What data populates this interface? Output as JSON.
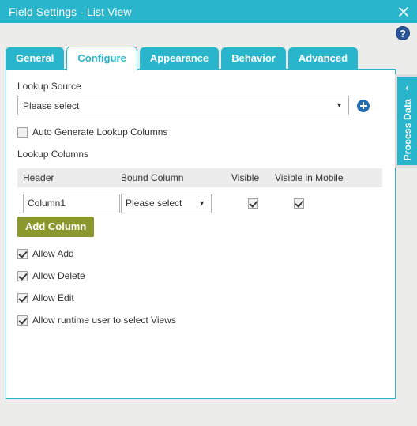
{
  "window": {
    "title": "Field Settings - List View",
    "close_icon": "close-icon",
    "help_icon": "help-icon",
    "help_glyph": "?"
  },
  "tabs": [
    {
      "label": "General",
      "active": false
    },
    {
      "label": "Configure",
      "active": true
    },
    {
      "label": "Appearance",
      "active": false
    },
    {
      "label": "Behavior",
      "active": false
    },
    {
      "label": "Advanced",
      "active": false
    }
  ],
  "configure": {
    "lookup_source_label": "Lookup Source",
    "lookup_source_value": "Please select",
    "lookup_source_caret": "▼",
    "add_lookup_source_icon": "plus-icon",
    "auto_generate_label": "Auto Generate Lookup Columns",
    "auto_generate_checked": false,
    "lookup_columns_label": "Lookup Columns",
    "grid": {
      "headers": [
        "Header",
        "Bound Column",
        "Visible",
        "Visible in Mobile"
      ],
      "rows": [
        {
          "header_value": "Column1",
          "bound_column_value": "Please select",
          "bound_column_caret": "▼",
          "visible_checked": true,
          "visible_in_mobile_checked": true
        }
      ]
    },
    "add_column_label": "Add Column",
    "permissions": [
      {
        "label": "Allow Add",
        "checked": true
      },
      {
        "label": "Allow Delete",
        "checked": true
      },
      {
        "label": "Allow Edit",
        "checked": true
      },
      {
        "label": "Allow runtime user to select Views",
        "checked": true
      }
    ]
  },
  "side_panel": {
    "label": "Process Data",
    "chevron": "‹",
    "chevron_icon": "chevron-left-icon"
  },
  "colors": {
    "accent_teal": "#29b6cd",
    "button_olive": "#8a982d",
    "plus_blue": "#1f6cb0",
    "help_blue": "#2a5699",
    "page_bg": "#ececea"
  }
}
